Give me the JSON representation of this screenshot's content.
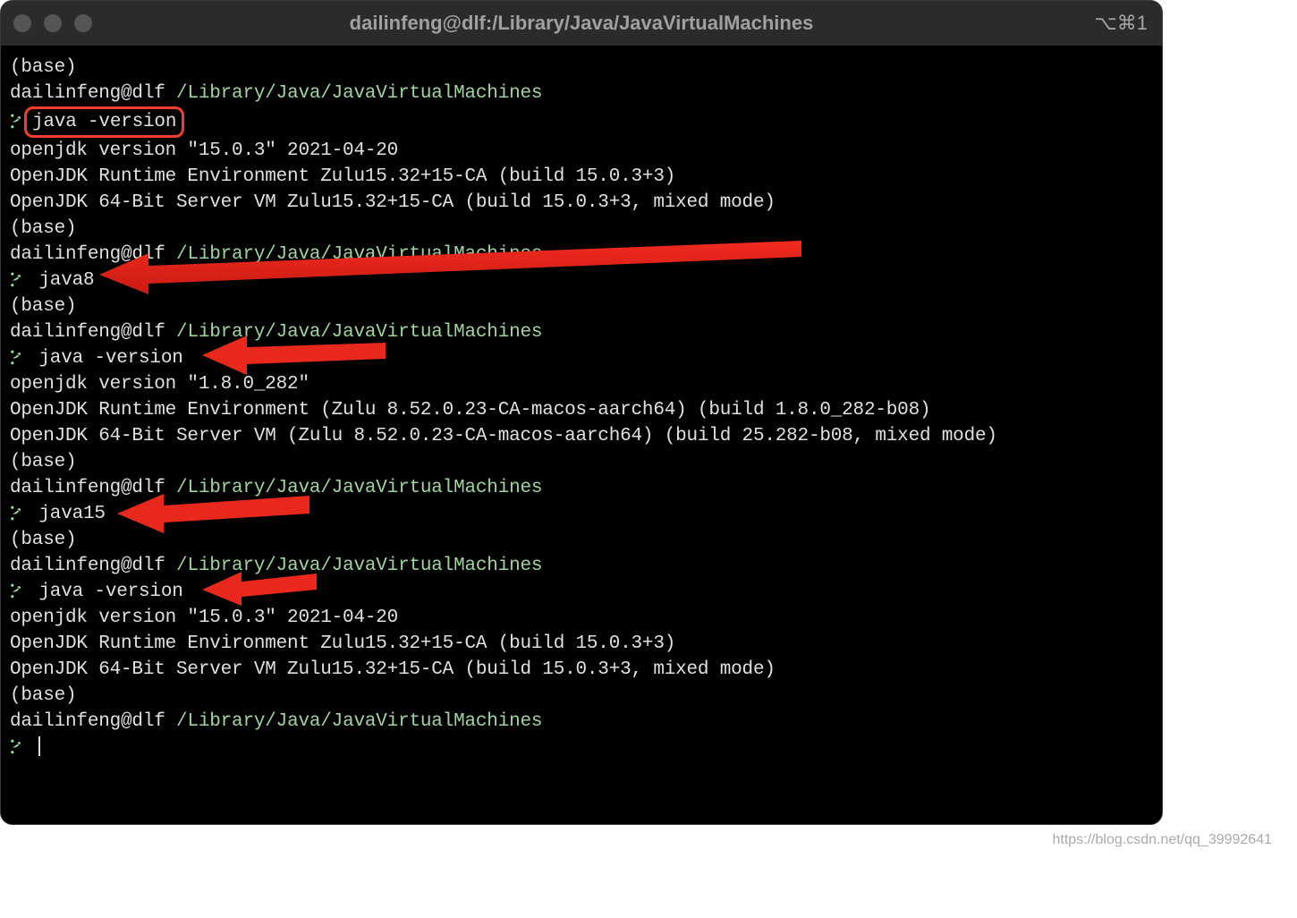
{
  "title": "dailinfeng@dlf:/Library/Java/JavaVirtualMachines",
  "shortcut": "⌥⌘1",
  "prompt": {
    "user_host": "dailinfeng@dlf",
    "path": " /Library/Java/JavaVirtualMachines",
    "base": "(base)"
  },
  "cmds": {
    "java_version": "java -version",
    "java8": "java8",
    "java15": "java15"
  },
  "output": {
    "v15_line1": "openjdk version \"15.0.3\" 2021-04-20",
    "v15_line2": "OpenJDK Runtime Environment Zulu15.32+15-CA (build 15.0.3+3)",
    "v15_line3": "OpenJDK 64-Bit Server VM Zulu15.32+15-CA (build 15.0.3+3, mixed mode)",
    "v8_line1": "openjdk version \"1.8.0_282\"",
    "v8_line2": "OpenJDK Runtime Environment (Zulu 8.52.0.23-CA-macos-aarch64) (build 1.8.0_282-b08)",
    "v8_line3": "OpenJDK 64-Bit Server VM (Zulu 8.52.0.23-CA-macos-aarch64) (build 25.282-b08, mixed mode)"
  },
  "watermark": "https://blog.csdn.net/qq_39992641"
}
